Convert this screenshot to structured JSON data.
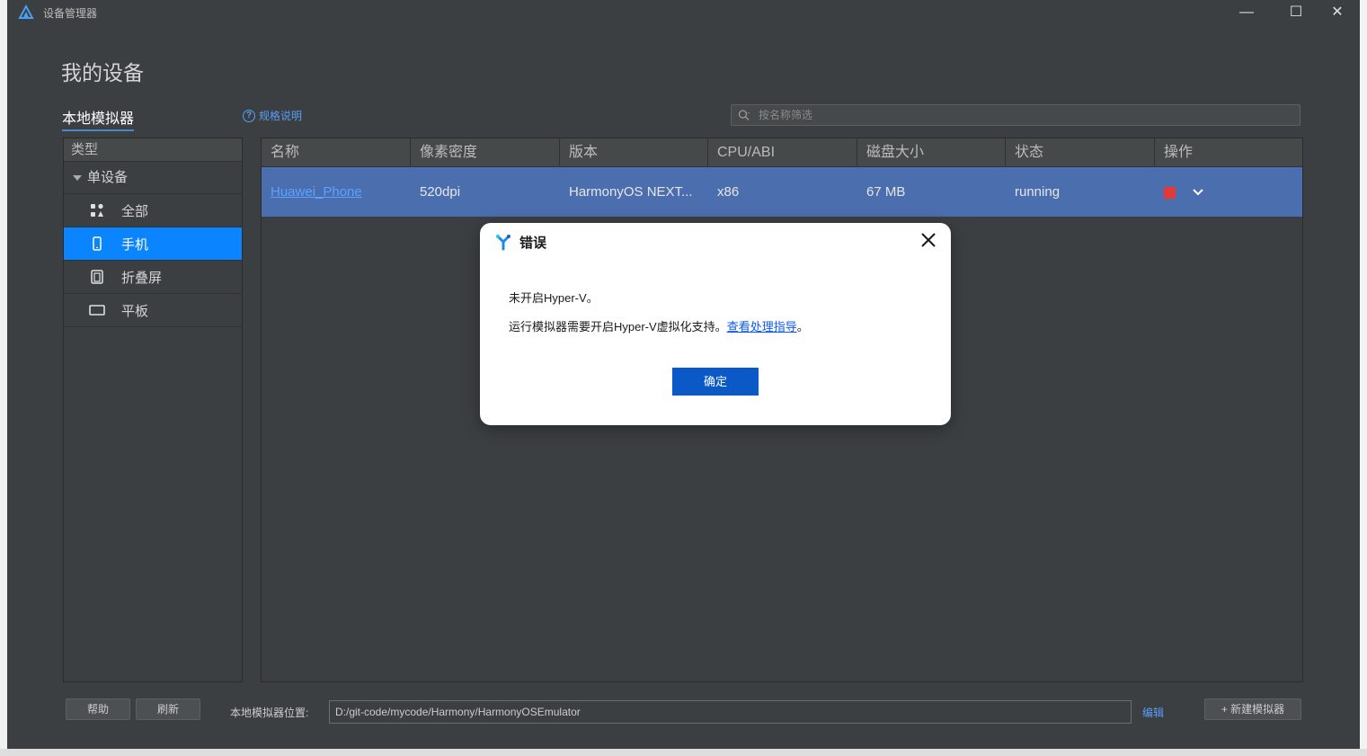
{
  "window": {
    "title": "设备管理器",
    "minimize": "—",
    "maximize": "☐",
    "close": "✕"
  },
  "page": {
    "title": "我的设备",
    "section_tab": "本地模拟器",
    "spec_link": "规格说明",
    "search_placeholder": "按名称筛选"
  },
  "types": {
    "header": "类型",
    "group": "单设备",
    "items": [
      {
        "label": "全部",
        "icon": "grid-icon"
      },
      {
        "label": "手机",
        "icon": "phone-icon"
      },
      {
        "label": "折叠屏",
        "icon": "foldable-icon"
      },
      {
        "label": "平板",
        "icon": "tablet-icon"
      }
    ],
    "active_item": "手机"
  },
  "table": {
    "columns": [
      "名称",
      "像素密度",
      "版本",
      "CPU/ABI",
      "磁盘大小",
      "状态",
      "操作"
    ],
    "rows": [
      {
        "name": "Huawei_Phone",
        "density": "520dpi",
        "version": "HarmonyOS NEXT...",
        "cpu": "x86",
        "disk": "67 MB",
        "status": "running"
      }
    ]
  },
  "footer": {
    "help": "帮助",
    "refresh": "刷新",
    "location_label": "本地模拟器位置:",
    "location_value": "D:/git-code/mycode/Harmony/HarmonyOSEmulator",
    "edit": "编辑",
    "new_emulator": "+ 新建模拟器"
  },
  "dialog": {
    "title": "错误",
    "message1": "未开启Hyper-V。",
    "message2_prefix": "运行模拟器需要开启Hyper-V虚拟化支持。",
    "message2_link": "查看处理指导",
    "message2_suffix": "。",
    "ok": "确定"
  },
  "colors": {
    "accent": "#0a84ff",
    "row_selected": "#4b6eaf",
    "stop": "#e53935",
    "dialog_button": "#0a59c7",
    "link": "#589df6"
  }
}
